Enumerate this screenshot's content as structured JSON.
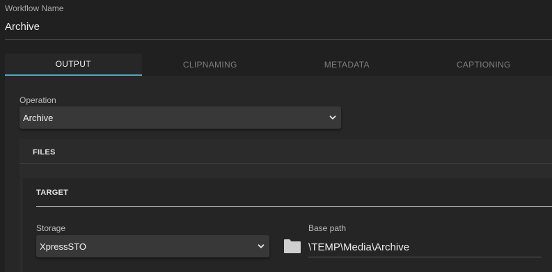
{
  "workflow": {
    "label": "Workflow Name",
    "value": "Archive"
  },
  "tabs": [
    {
      "label": "OUTPUT",
      "active": true
    },
    {
      "label": "CLIPNAMING",
      "active": false
    },
    {
      "label": "METADATA",
      "active": false
    },
    {
      "label": "CAPTIONING",
      "active": false
    }
  ],
  "operation": {
    "label": "Operation",
    "selected": "Archive"
  },
  "files": {
    "title": "FILES"
  },
  "target": {
    "title": "TARGET",
    "storage": {
      "label": "Storage",
      "selected": "XpressSTO"
    },
    "base_path": {
      "label": "Base path",
      "value": "\\TEMP\\Media\\Archive"
    }
  },
  "colors": {
    "background": "#202020",
    "accent": "#4aa8d6",
    "select_bg": "#383838"
  },
  "icons": {
    "dropdown": "chevron-down-icon",
    "browse": "folder-icon"
  }
}
